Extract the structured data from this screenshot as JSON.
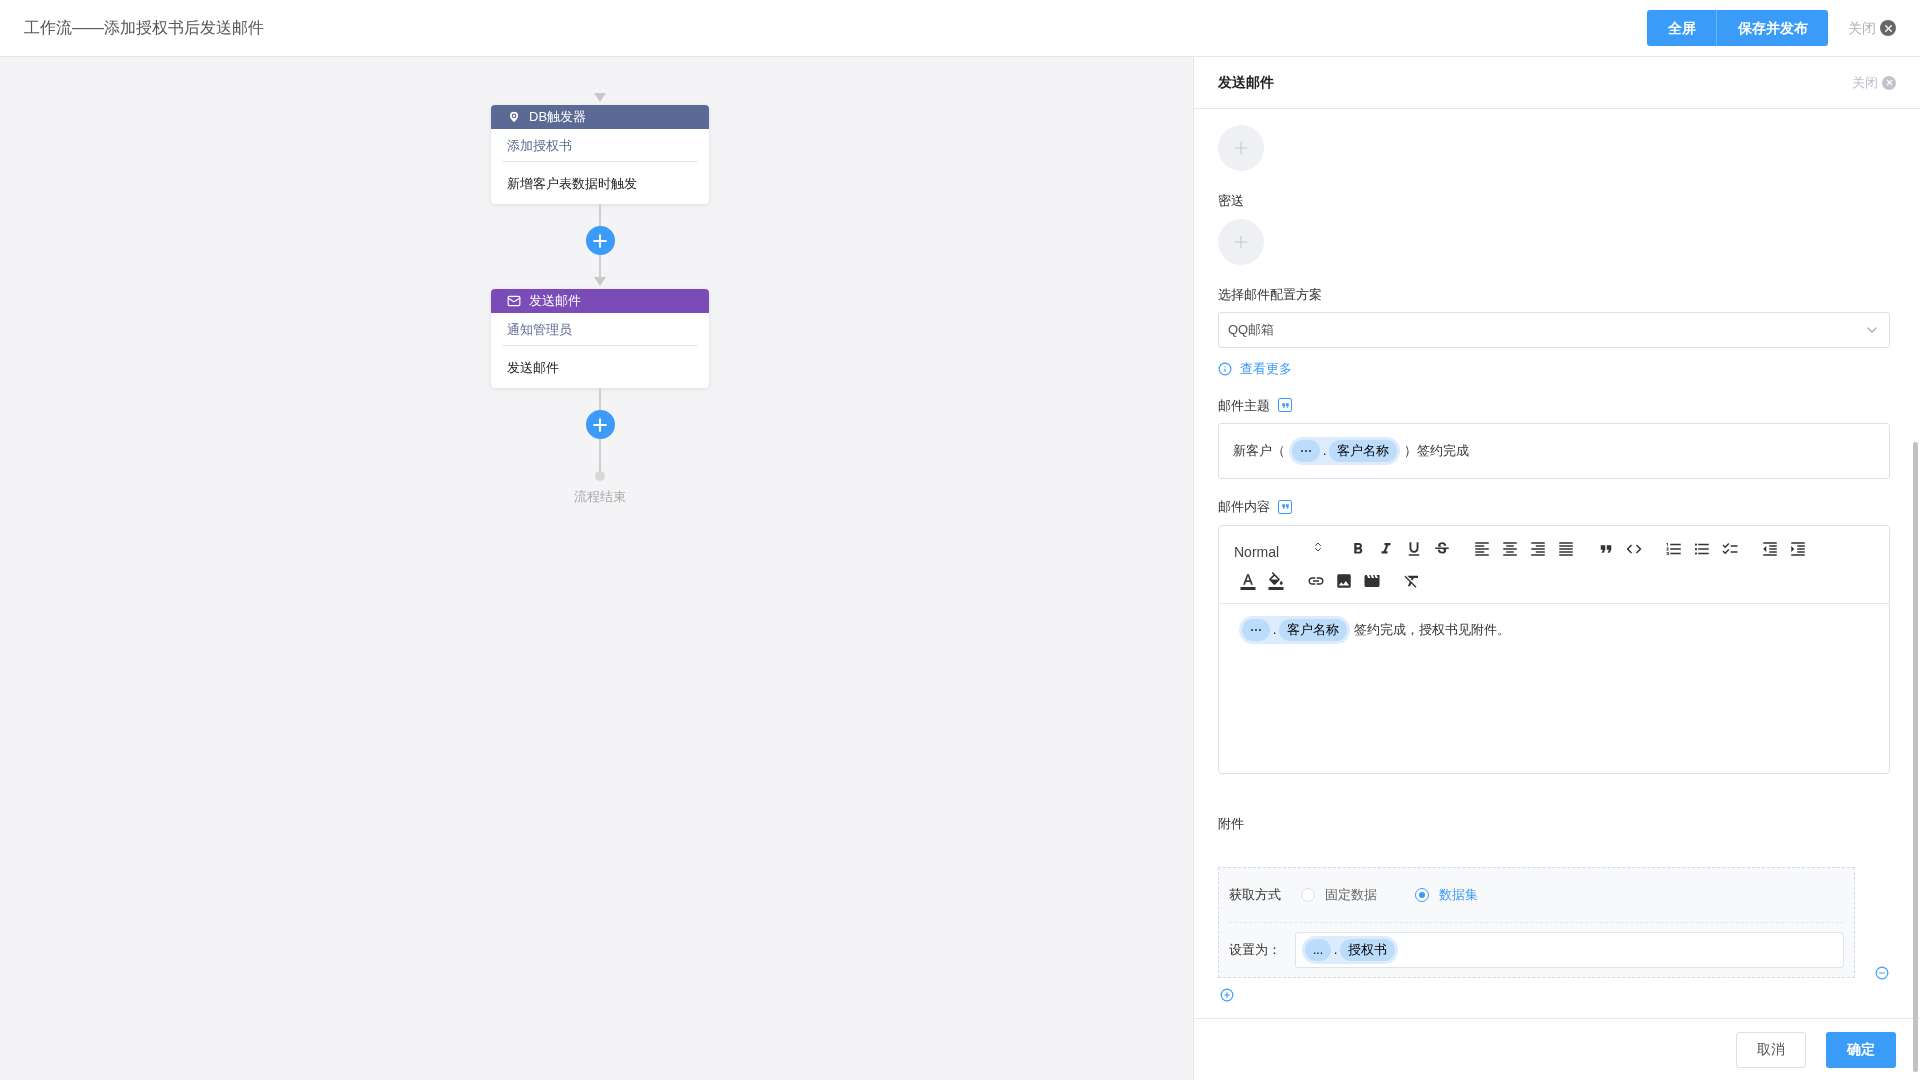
{
  "header": {
    "title": "工作流——添加授权书后发送邮件",
    "buttons": [
      "全屏",
      "保存并发布"
    ],
    "close": "关闭"
  },
  "flow": {
    "nodes": [
      {
        "kind": "trigger",
        "color": "#5a6a94",
        "title": "DB触发器",
        "name": "添加授权书",
        "desc": "新增客户表数据时触发"
      },
      {
        "kind": "mail",
        "color": "#7b4bb7",
        "title": "发送邮件",
        "name": "通知管理员",
        "desc": "发送邮件"
      }
    ],
    "end": "流程结束"
  },
  "panel": {
    "title": "发送邮件",
    "close": "关闭",
    "bcc_label": "密送",
    "config_label": "选择邮件配置方案",
    "config_value": "QQ邮箱",
    "more_link": "查看更多",
    "subject_label": "邮件主题",
    "subject": [
      {
        "kind": "text",
        "text": "新客户（"
      },
      {
        "kind": "token",
        "path": "⋯",
        "dot": ".",
        "field": "客户名称"
      },
      {
        "kind": "text",
        "text": "）签约完成"
      }
    ],
    "content_label": "邮件内容",
    "format": "Normal",
    "content": [
      {
        "kind": "token",
        "path": "⋯",
        "dot": ".",
        "field": "客户名称"
      },
      {
        "kind": "text",
        "text": "签约完成，授权书见附件。"
      }
    ],
    "attachment_label": "附件",
    "source_label": "获取方式",
    "source_options": [
      {
        "label": "固定数据",
        "selected": false
      },
      {
        "label": "数据集",
        "selected": true
      }
    ],
    "set_label": "设置为：",
    "set_value": [
      {
        "kind": "token",
        "path": "...",
        "dot": ".",
        "field": "授权书"
      }
    ],
    "buttons": [
      "取消",
      "确定"
    ]
  }
}
